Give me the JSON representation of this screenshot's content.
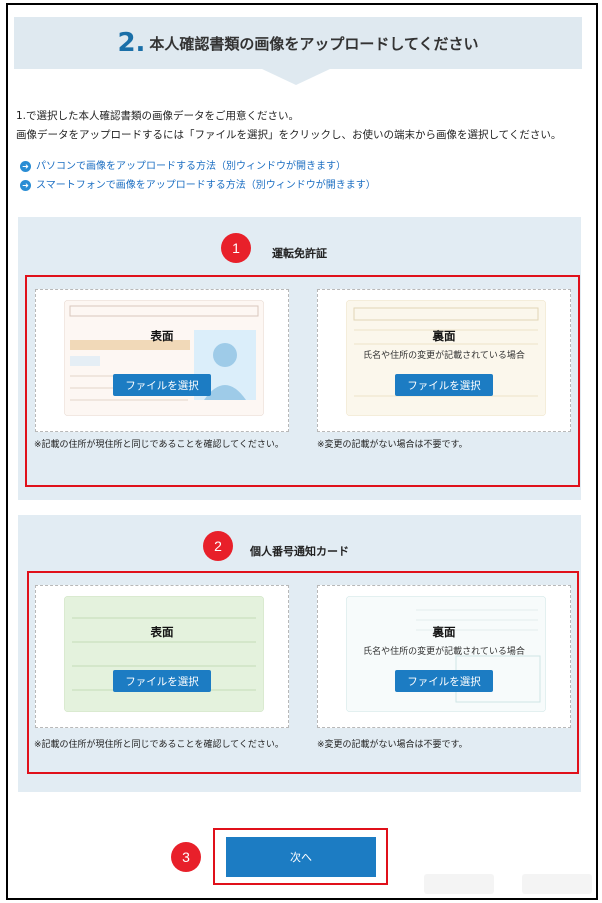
{
  "header": {
    "step_number": "2.",
    "title": "本人確認書類の画像をアップロードしてください"
  },
  "intro": {
    "line1": "1.で選択した本人確認書類の画像データをご用意ください。",
    "line2": "画像データをアップロードするには「ファイルを選択」をクリックし、お使いの端末から画像を選択してください。"
  },
  "links": [
    {
      "label": "パソコンで画像をアップロードする方法（別ウィンドウが開きます）"
    },
    {
      "label": "スマートフォンで画像をアップロードする方法（別ウィンドウが開きます）"
    }
  ],
  "sections": [
    {
      "badge": "1",
      "title": "運転免許証",
      "front": {
        "label": "表面",
        "button": "ファイルを選択",
        "note": "※記載の住所が現住所と同じであることを確認してください。"
      },
      "back": {
        "label": "裏面",
        "sub": "氏名や住所の変更が記載されている場合",
        "button": "ファイルを選択",
        "note": "※変更の記載がない場合は不要です。"
      }
    },
    {
      "badge": "2",
      "title": "個人番号通知カード",
      "front": {
        "label": "表面",
        "button": "ファイルを選択",
        "note": "※記載の住所が現住所と同じであることを確認してください。"
      },
      "back": {
        "label": "裏面",
        "sub": "氏名や住所の変更が記載されている場合",
        "button": "ファイルを選択",
        "note": "※変更の記載がない場合は不要です。"
      }
    }
  ],
  "next": {
    "badge": "3",
    "label": "次へ"
  },
  "colors": {
    "accent": "#1c7cc3",
    "highlight": "#e0101a",
    "section_bg": "#e2ecf3"
  }
}
